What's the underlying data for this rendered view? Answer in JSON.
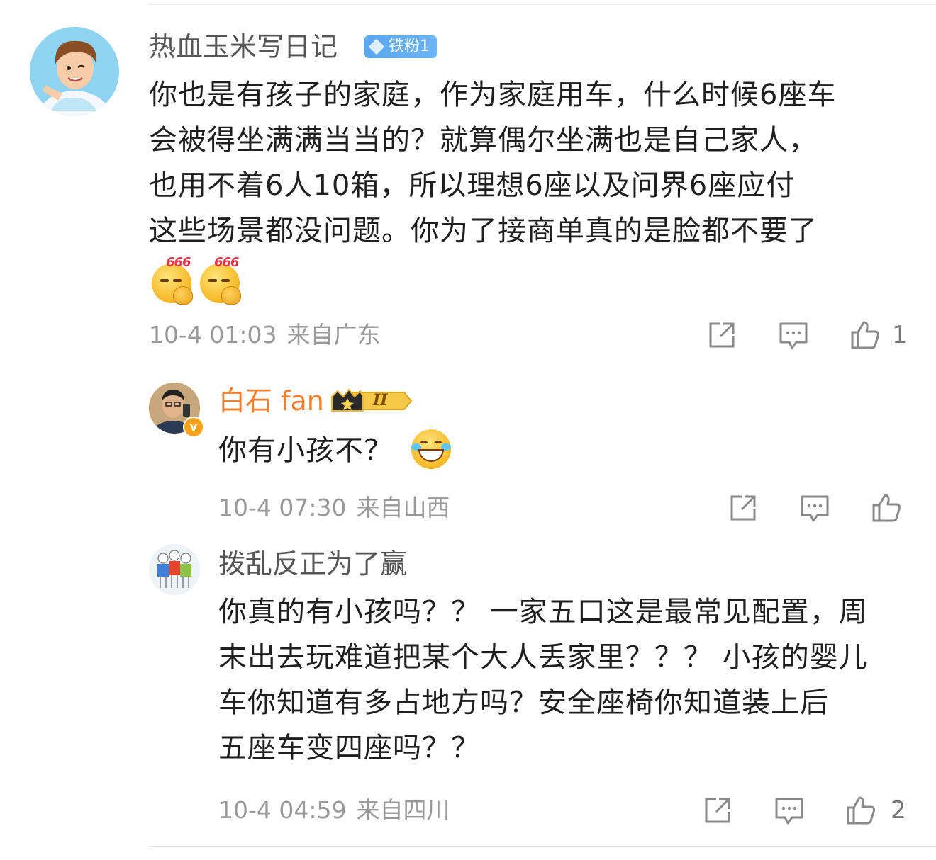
{
  "comments": [
    {
      "author": "热血玉米写日记",
      "fan_badge": "铁粉1",
      "lines": [
        "你也是有孩子的家庭，作为家庭用车，什么时候6座车",
        "会被得坐满满当当的？就算偶尔坐满也是自己家人，",
        "也用不着6人10箱，所以理想6座以及问界6座应付",
        "这些场景都没问题。你为了接商单真的是脸都不要了"
      ],
      "emoji_label": "666",
      "time": "10-4 01:03",
      "location": "来自广东",
      "like_count": "1"
    },
    {
      "author": "白石 fan",
      "level_badge": "II",
      "verified_mark": "v",
      "lines": [
        "你有小孩不？"
      ],
      "time": "10-4 07:30",
      "location": "来自山西",
      "like_count": ""
    },
    {
      "author": "拨乱反正为了赢",
      "lines": [
        "你真的有小孩吗？？ 一家五口这是最常见配置，周",
        "末出去玩难道把某个大人丢家里？？？ 小孩的婴儿",
        "车你知道有多占地方吗？安全座椅你知道装上后",
        "五座车变四座吗？？"
      ],
      "time": "10-4 04:59",
      "location": "来自四川",
      "like_count": "2"
    }
  ],
  "icons": {
    "share": "share-icon",
    "reply": "comment-icon",
    "like": "thumbs-up-icon"
  },
  "colors": {
    "vip_name": "#f08030",
    "fan_badge": "#5aa7f0",
    "meta_text": "#999999"
  }
}
